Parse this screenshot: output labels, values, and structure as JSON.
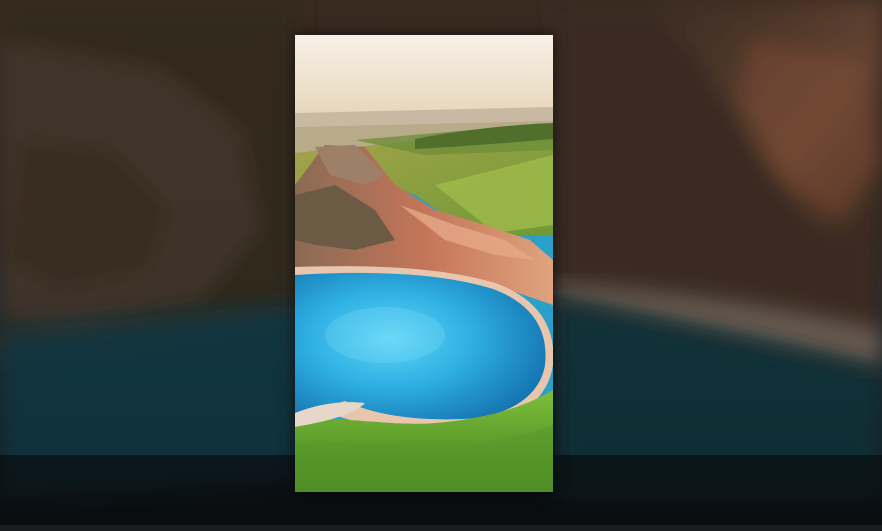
{
  "viewer": {
    "background_tone": "#0d1114",
    "photo": {
      "subject": "coastal-cove-aerial-icon",
      "colors": {
        "sky_top": "#f6efe3",
        "sky_bottom": "#e9d9c1",
        "water_light": "#41c4ef",
        "water_deep": "#1678b6",
        "cliff": "#c9765c",
        "grass": "#7fb63a",
        "sand": "#e8c7b0"
      }
    }
  }
}
